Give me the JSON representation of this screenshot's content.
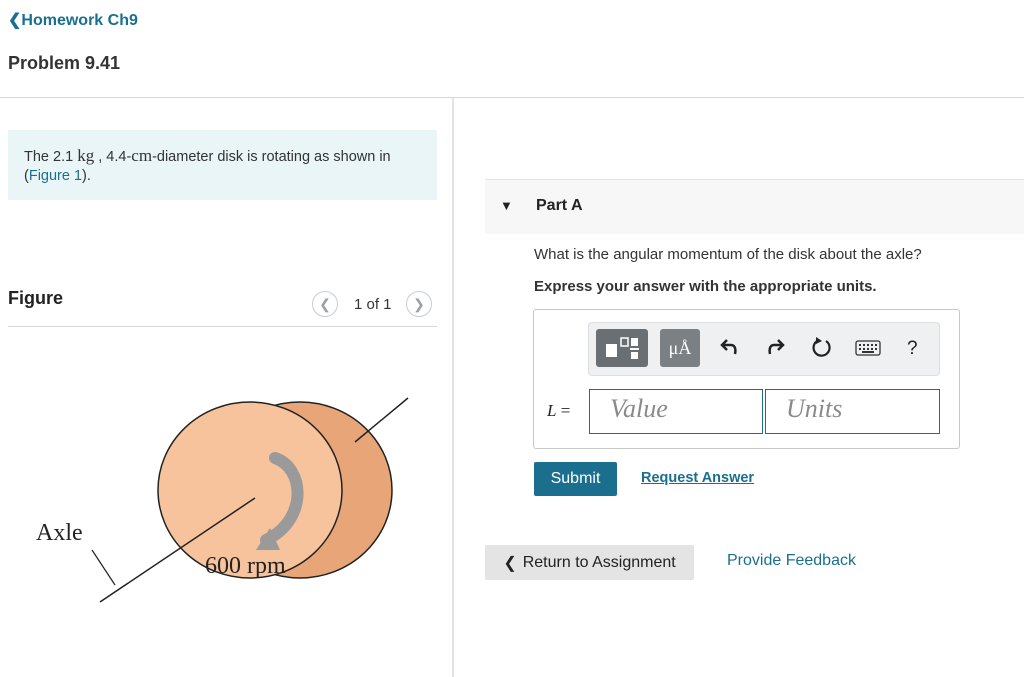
{
  "header": {
    "back_label": "Homework Ch9",
    "back_icon": "chevron-left-icon",
    "problem_title": "Problem 9.41"
  },
  "intro": {
    "text_before": "The 2.1 ",
    "mass_unit": "kg",
    "text_middle": " , 4.4-",
    "length_unit": "cm",
    "text_after": "-diameter disk is rotating as shown in (",
    "figure_link": "Figure 1",
    "text_end": ")."
  },
  "figure": {
    "heading": "Figure",
    "counter": "1 of 1",
    "prev_icon": "chevron-left-icon",
    "next_icon": "chevron-right-icon",
    "axle_label": "Axle",
    "speed_label": "600 rpm",
    "disk_color": "#f6c39c"
  },
  "part": {
    "title": "Part A",
    "question": "What is the angular momentum of the disk about the axle?",
    "instruction": "Express your answer with the appropriate units.",
    "variable": "L",
    "equals": " =",
    "toolbar": {
      "units_symbol": "μÅ",
      "help": "?"
    },
    "value_placeholder": "Value",
    "units_placeholder": "Units",
    "submit_label": "Submit",
    "request_answer_label": "Request Answer"
  },
  "footer": {
    "return_label": "Return to Assignment",
    "feedback_label": "Provide Feedback"
  },
  "colors": {
    "accent": "#1a6f8e",
    "intro_bg": "#e9f5f7"
  }
}
